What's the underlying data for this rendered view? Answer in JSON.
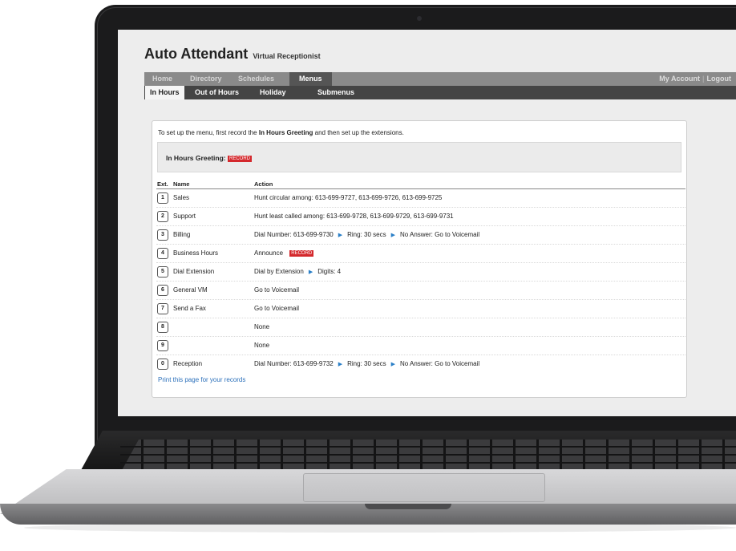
{
  "app": {
    "title": "Auto Attendant",
    "subtitle": "Virtual Receptionist"
  },
  "topnav": {
    "tabs": [
      "Home",
      "Directory",
      "Schedules",
      "Menus"
    ],
    "active": "Menus",
    "my_account": "My Account",
    "separator": "|",
    "logout": "Logout"
  },
  "subnav": {
    "tabs": [
      "In Hours",
      "Out of Hours",
      "Holiday",
      "Submenus"
    ],
    "active": "In Hours"
  },
  "intro": {
    "text_before": "To set up the menu, first record the ",
    "bold": "In Hours Greeting",
    "text_after": " and then set up the extensions."
  },
  "greeting": {
    "label": "In Hours Greeting:",
    "record_label": "RECORD"
  },
  "table": {
    "headers": {
      "ext": "Ext.",
      "name": "Name",
      "action": "Action"
    },
    "rows": [
      {
        "ext": "1",
        "name": "Sales",
        "action": [
          "Hunt circular among: 613-699-9727, 613-699-9726, 613-699-9725"
        ]
      },
      {
        "ext": "2",
        "name": "Support",
        "action": [
          "Hunt least called among: 613-699-9728, 613-699-9729, 613-699-9731"
        ]
      },
      {
        "ext": "3",
        "name": "Billing",
        "action": [
          "Dial Number: 613-699-9730",
          "Ring: 30 secs",
          "No Answer: Go to Voicemail"
        ]
      },
      {
        "ext": "4",
        "name": "Business Hours",
        "action": [
          "Announce"
        ],
        "record": "RECORD"
      },
      {
        "ext": "5",
        "name": "Dial Extension",
        "action": [
          "Dial by Extension",
          "Digits: 4"
        ]
      },
      {
        "ext": "6",
        "name": "General VM",
        "action": [
          "Go to Voicemail"
        ]
      },
      {
        "ext": "7",
        "name": "Send a Fax",
        "action": [
          "Go to Voicemail"
        ]
      },
      {
        "ext": "8",
        "name": "",
        "action": [
          "None"
        ]
      },
      {
        "ext": "9",
        "name": "",
        "action": [
          "None"
        ]
      },
      {
        "ext": "0",
        "name": "Reception",
        "action": [
          "Dial Number: 613-699-9732",
          "Ring: 30 secs",
          "No Answer: Go to Voicemail"
        ]
      }
    ]
  },
  "print_link": "Print this page for your records",
  "colors": {
    "record_red": "#d4282c",
    "arrow_blue": "#2a7fc7",
    "link_blue": "#2a6fba",
    "topnav_gray": "#8a8a8a",
    "subnav_dark": "#444444"
  }
}
